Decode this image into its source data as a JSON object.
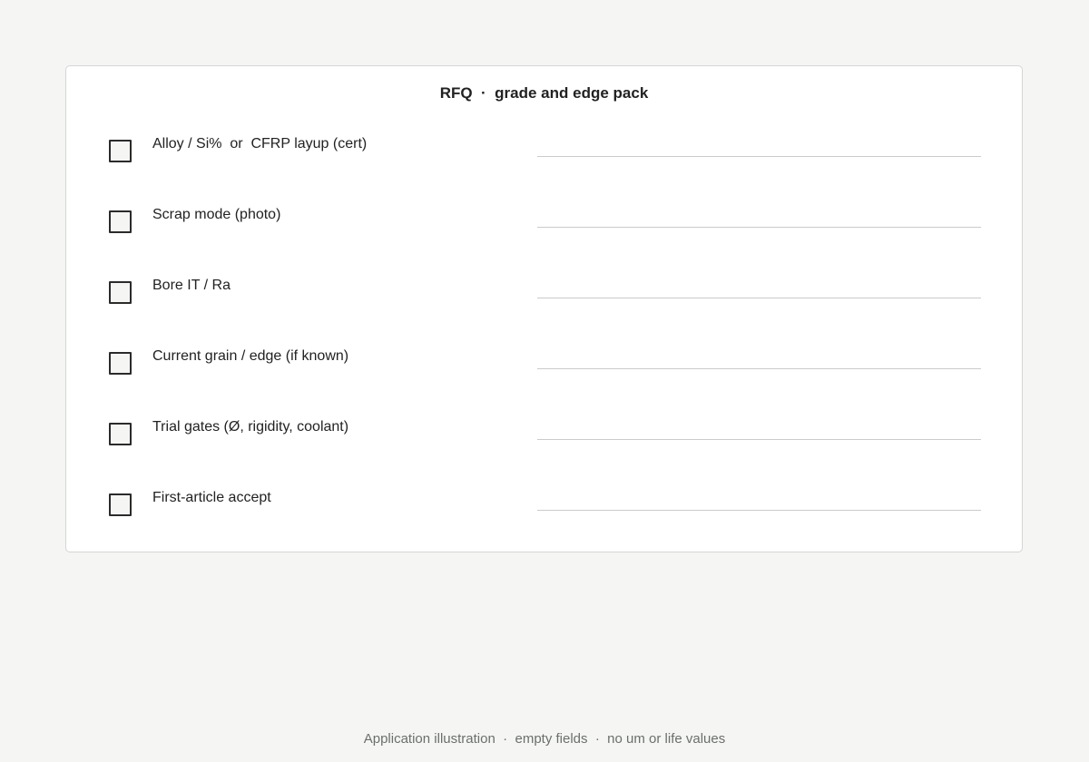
{
  "form": {
    "title": "RFQ  ·  grade and edge pack",
    "rows": [
      {
        "label": "Alloy / Si%  or  CFRP layup (cert)",
        "checked": false,
        "value": ""
      },
      {
        "label": "Scrap mode (photo)",
        "checked": false,
        "value": ""
      },
      {
        "label": "Bore IT / Ra",
        "checked": false,
        "value": ""
      },
      {
        "label": "Current grain / edge (if known)",
        "checked": false,
        "value": ""
      },
      {
        "label": "Trial gates (Ø, rigidity, coolant)",
        "checked": false,
        "value": ""
      },
      {
        "label": "First-article accept",
        "checked": false,
        "value": ""
      }
    ]
  },
  "footer": {
    "text": "Application illustration  ·  empty fields  ·  no um or life values"
  },
  "colors": {
    "page_background": "#f5f6f4",
    "card_background": "#ffffff",
    "text": "#222222",
    "muted_text": "#6b6f6b",
    "rule": "#c9ccc8"
  }
}
